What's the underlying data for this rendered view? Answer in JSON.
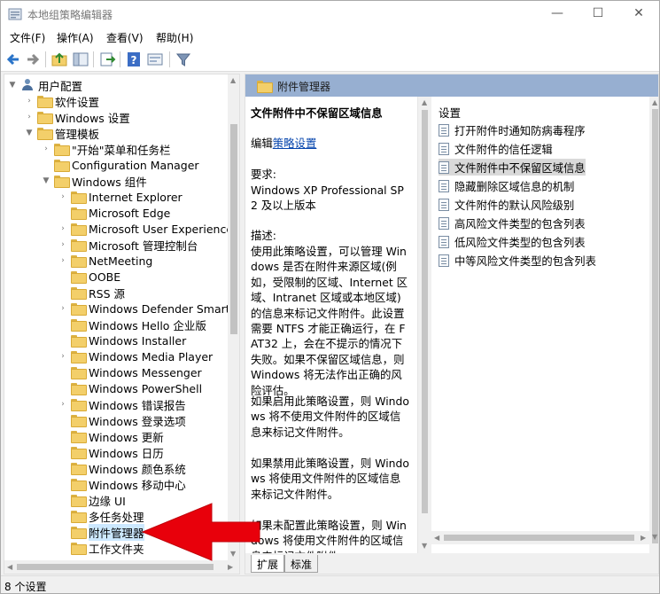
{
  "window": {
    "title": "本地组策略编辑器"
  },
  "menu": [
    "文件(F)",
    "操作(A)",
    "查看(V)",
    "帮助(H)"
  ],
  "tree": [
    {
      "label": "用户配置",
      "chev": "▼",
      "icon": "person",
      "indent": 0
    },
    {
      "label": "软件设置",
      "chev": "›",
      "icon": "folder",
      "indent": 1
    },
    {
      "label": "Windows 设置",
      "chev": "›",
      "icon": "folder",
      "indent": 1
    },
    {
      "label": "管理模板",
      "chev": "▼",
      "icon": "folder",
      "indent": 1
    },
    {
      "label": "\"开始\"菜单和任务栏",
      "chev": "›",
      "icon": "folder",
      "indent": 2
    },
    {
      "label": "Configuration Manager",
      "chev": "",
      "icon": "folder",
      "indent": 2
    },
    {
      "label": "Windows 组件",
      "chev": "▼",
      "icon": "folder",
      "indent": 2
    },
    {
      "label": "Internet Explorer",
      "chev": "›",
      "icon": "folder",
      "indent": 3
    },
    {
      "label": "Microsoft Edge",
      "chev": "",
      "icon": "folder",
      "indent": 3
    },
    {
      "label": "Microsoft User Experience",
      "chev": "›",
      "icon": "folder",
      "indent": 3
    },
    {
      "label": "Microsoft 管理控制台",
      "chev": "›",
      "icon": "folder",
      "indent": 3
    },
    {
      "label": "NetMeeting",
      "chev": "›",
      "icon": "folder",
      "indent": 3
    },
    {
      "label": "OOBE",
      "chev": "",
      "icon": "folder",
      "indent": 3
    },
    {
      "label": "RSS 源",
      "chev": "",
      "icon": "folder",
      "indent": 3
    },
    {
      "label": "Windows Defender Smart",
      "chev": "›",
      "icon": "folder",
      "indent": 3
    },
    {
      "label": "Windows Hello 企业版",
      "chev": "",
      "icon": "folder",
      "indent": 3
    },
    {
      "label": "Windows Installer",
      "chev": "",
      "icon": "folder",
      "indent": 3
    },
    {
      "label": "Windows Media Player",
      "chev": "›",
      "icon": "folder",
      "indent": 3
    },
    {
      "label": "Windows Messenger",
      "chev": "",
      "icon": "folder",
      "indent": 3
    },
    {
      "label": "Windows PowerShell",
      "chev": "",
      "icon": "folder",
      "indent": 3
    },
    {
      "label": "Windows 错误报告",
      "chev": "›",
      "icon": "folder",
      "indent": 3
    },
    {
      "label": "Windows 登录选项",
      "chev": "",
      "icon": "folder",
      "indent": 3
    },
    {
      "label": "Windows 更新",
      "chev": "",
      "icon": "folder",
      "indent": 3
    },
    {
      "label": "Windows 日历",
      "chev": "",
      "icon": "folder",
      "indent": 3
    },
    {
      "label": "Windows 颜色系统",
      "chev": "",
      "icon": "folder",
      "indent": 3
    },
    {
      "label": "Windows 移动中心",
      "chev": "",
      "icon": "folder",
      "indent": 3
    },
    {
      "label": "边缘 UI",
      "chev": "",
      "icon": "folder",
      "indent": 3
    },
    {
      "label": "多任务处理",
      "chev": "",
      "icon": "folder",
      "indent": 3
    },
    {
      "label": "附件管理器",
      "chev": "",
      "icon": "folder",
      "indent": 3,
      "selected": true
    },
    {
      "label": "工作文件夹",
      "chev": "",
      "icon": "folder",
      "indent": 3
    }
  ],
  "right": {
    "header": "附件管理器",
    "desc_title": "文件附件中不保留区域信息",
    "edit_prefix": "编辑",
    "edit_link": "策略设置",
    "requirements_label": "要求:",
    "requirements": "Windows XP Professional SP2 及以上版本",
    "description_label": "描述:",
    "description": "使用此策略设置，可以管理 Windows 是否在附件来源区域(例如，受限制的区域、Internet 区域、Intranet 区域或本地区域)的信息来标记文件附件。此设置需要 NTFS 才能正确运行，在 FAT32 上，会在不提示的情况下失败。如果不保留区域信息，则 Windows 将无法作出正确的风险评估。",
    "enabled_text": "如果启用此策略设置，则 Windows 将不使用文件附件的区域信息来标记文件附件。",
    "disabled_text": "如果禁用此策略设置，则 Windows 将使用文件附件的区域信息来标记文件附件。",
    "notconfigured_text": "如果未配置此策略设置，则 Windows 将使用文件附件的区域信息来标记文件附件。",
    "settings_header": "设置",
    "settings": [
      "打开附件时通知防病毒程序",
      "文件附件的信任逻辑",
      "文件附件中不保留区域信息",
      "隐藏删除区域信息的机制",
      "文件附件的默认风险级别",
      "高风险文件类型的包含列表",
      "低风险文件类型的包含列表",
      "中等风险文件类型的包含列表"
    ],
    "selected_setting": 2,
    "tabs": [
      "扩展",
      "标准"
    ]
  },
  "status": "8 个设置",
  "colors": {
    "header_band": "#97afd1",
    "selection": "#cce8ff",
    "arrow": "#e8000b"
  }
}
